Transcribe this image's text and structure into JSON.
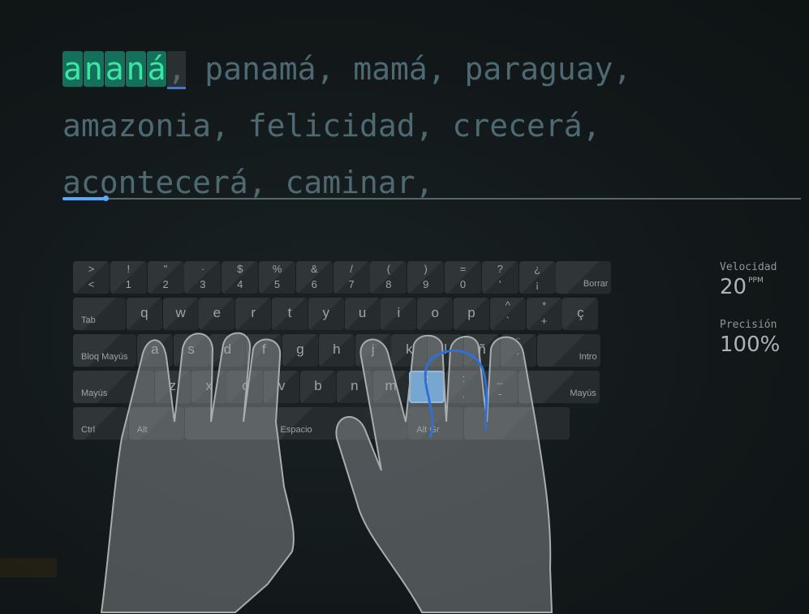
{
  "text_lines": [
    {
      "typed": [
        "a",
        "n",
        "a",
        "n",
        "á"
      ],
      "cursor": ",",
      "rest": " panamá, mamá, paraguay,"
    },
    {
      "rest": "amazonia, felicidad, crecerá,"
    },
    {
      "rest": "acontecerá, caminar,"
    }
  ],
  "progress": {
    "value": 0.058
  },
  "keyboard": {
    "rows": [
      [
        {
          "t": ">",
          "b": "<"
        },
        {
          "t": "!",
          "b": "1"
        },
        {
          "t": "\"",
          "b": "2"
        },
        {
          "t": "·",
          "b": "3"
        },
        {
          "t": "$",
          "b": "4"
        },
        {
          "t": "%",
          "b": "5"
        },
        {
          "t": "&",
          "b": "6"
        },
        {
          "t": "/",
          "b": "7"
        },
        {
          "t": "(",
          "b": "8"
        },
        {
          "t": ")",
          "b": "9"
        },
        {
          "t": "=",
          "b": "0"
        },
        {
          "t": "?",
          "b": "'"
        },
        {
          "t": "¿",
          "b": "¡"
        },
        {
          "label": "Borrar"
        }
      ],
      [
        {
          "label": "Tab"
        },
        {
          "c": "q"
        },
        {
          "c": "w"
        },
        {
          "c": "e"
        },
        {
          "c": "r"
        },
        {
          "c": "t"
        },
        {
          "c": "y"
        },
        {
          "c": "u"
        },
        {
          "c": "i"
        },
        {
          "c": "o"
        },
        {
          "c": "p"
        },
        {
          "t": "^",
          "b": "`"
        },
        {
          "t": "*",
          "b": "+"
        },
        {
          "c": "ç"
        }
      ],
      [
        {
          "label": "Bloq Mayús"
        },
        {
          "c": "a"
        },
        {
          "c": "s"
        },
        {
          "c": "d"
        },
        {
          "c": "f"
        },
        {
          "c": "g"
        },
        {
          "c": "h"
        },
        {
          "c": "j"
        },
        {
          "c": "k"
        },
        {
          "c": "l"
        },
        {
          "c": "ñ"
        },
        {
          "t": "¨",
          "b": "´"
        },
        {
          "label": "Intro"
        }
      ],
      [
        {
          "label": "Mayús"
        },
        {
          "c": "z"
        },
        {
          "c": "x"
        },
        {
          "c": "c"
        },
        {
          "c": "v"
        },
        {
          "c": "b"
        },
        {
          "c": "n"
        },
        {
          "c": "m"
        },
        {
          "t": ";",
          "b": ",",
          "active": true
        },
        {
          "t": ":",
          "b": "."
        },
        {
          "t": "_",
          "b": "-"
        },
        {
          "label": "Mayús"
        }
      ],
      [
        {
          "label": "Ctrl"
        },
        {
          "label": "Alt"
        },
        {
          "label": "Espacio"
        },
        {
          "label": "Alt Gr"
        },
        {
          "label": ""
        }
      ]
    ]
  },
  "stats": {
    "speed_label": "Velocidad",
    "speed_value": "20",
    "speed_unit": "PPM",
    "accuracy_label": "Precisión",
    "accuracy_value": "100%"
  },
  "colors": {
    "typed_bg": "#15705b",
    "typed_fg": "#3ee6a4",
    "pending_fg": "#4d6a72",
    "active_key": "#5aa9f0",
    "finger_guide": "#2f6fd6"
  }
}
